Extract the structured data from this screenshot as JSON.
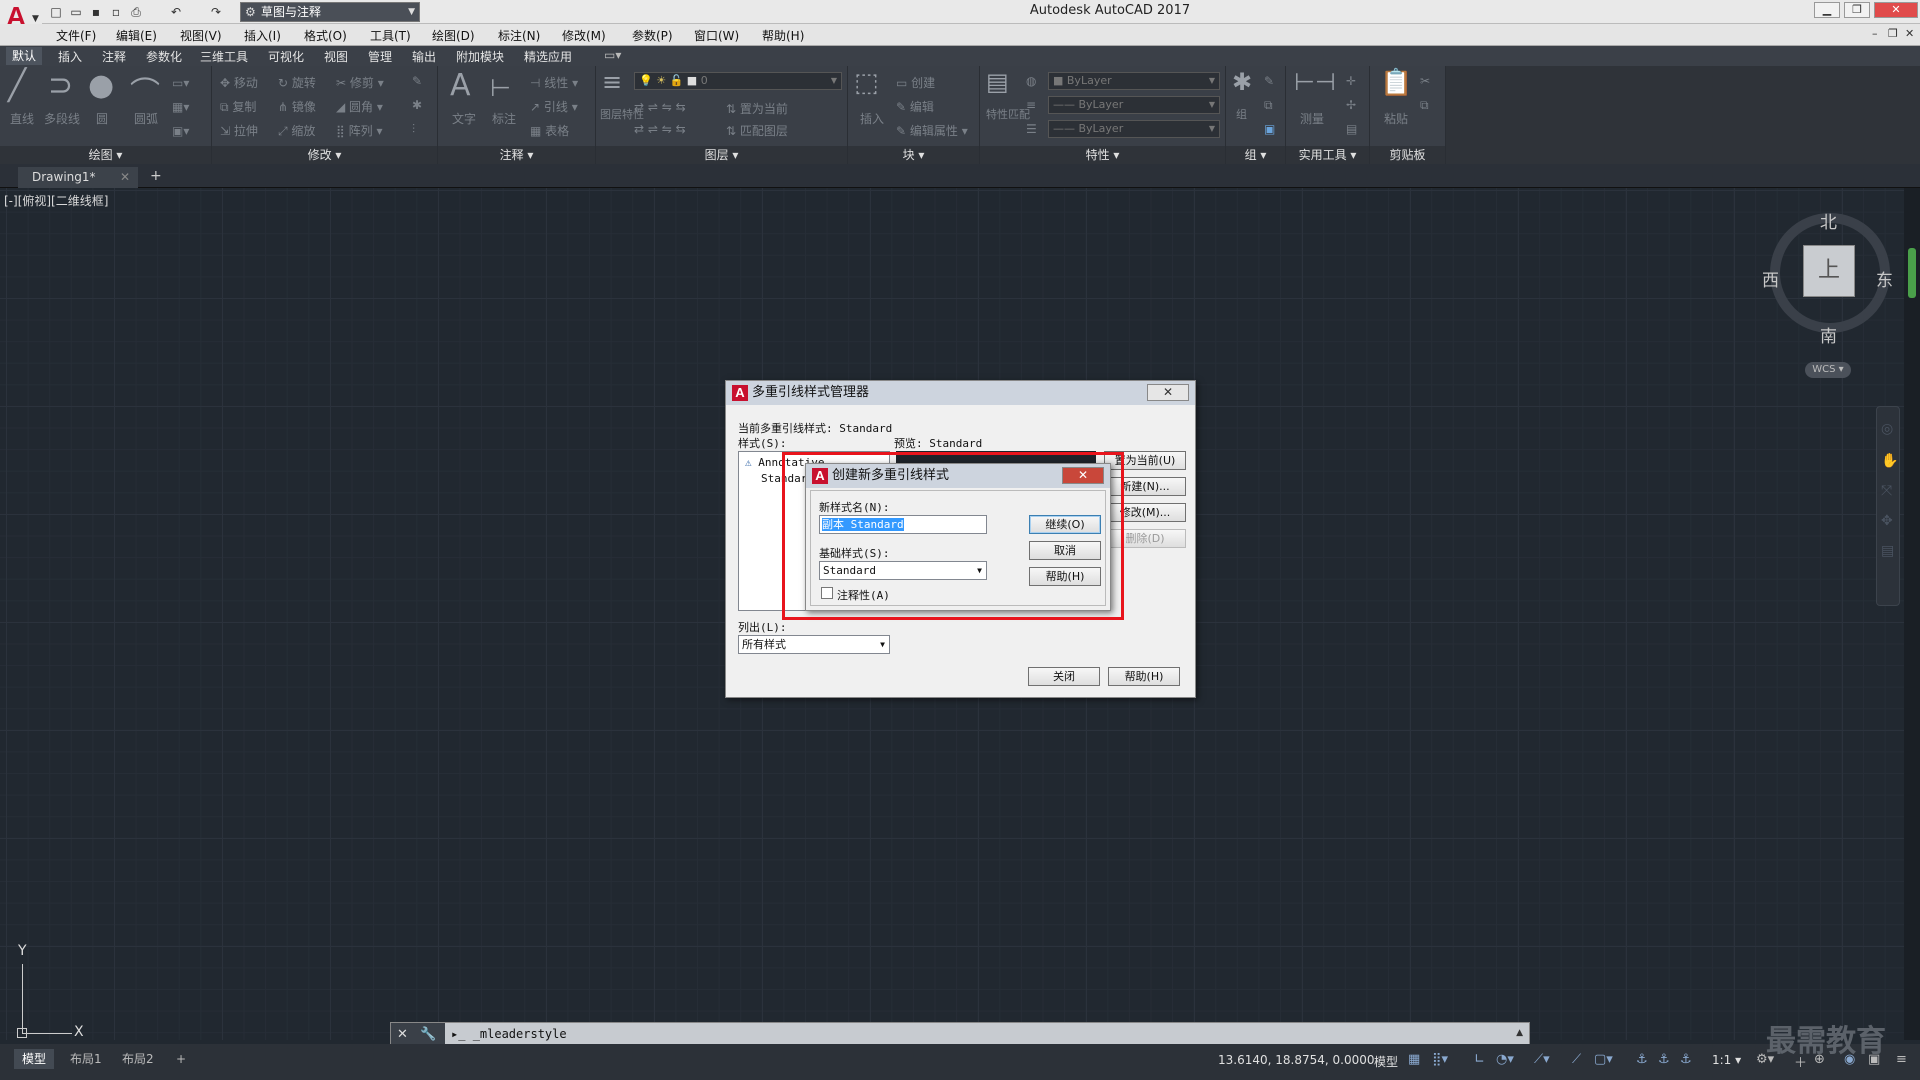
{
  "titlebar": {
    "app_title": "Autodesk AutoCAD 2017",
    "workspace": "草图与注释",
    "logo": "A",
    "qat_icons": [
      "new-icon",
      "open-icon",
      "save-icon",
      "saveas-icon",
      "print-icon",
      "undo-icon",
      "redo-icon"
    ]
  },
  "menubar": [
    "文件(F)",
    "编辑(E)",
    "视图(V)",
    "插入(I)",
    "格式(O)",
    "工具(T)",
    "绘图(D)",
    "标注(N)",
    "修改(M)",
    "参数(P)",
    "窗口(W)",
    "帮助(H)"
  ],
  "ribbon": {
    "tabs": [
      "默认",
      "插入",
      "注释",
      "参数化",
      "三维工具",
      "可视化",
      "视图",
      "管理",
      "输出",
      "附加模块",
      "精选应用"
    ],
    "active_tab": "默认",
    "panels": [
      "绘图",
      "修改",
      "注释",
      "图层",
      "块",
      "特性",
      "组",
      "实用工具",
      "剪贴板"
    ],
    "draw_tools": [
      "直线",
      "多段线",
      "圆",
      "圆弧"
    ],
    "modify_tools": [
      "移动",
      "旋转",
      "修剪",
      "复制",
      "镜像",
      "圆角",
      "拉伸",
      "缩放",
      "阵列"
    ],
    "annotate_tools": [
      "文字",
      "标注",
      "线性",
      "引线",
      "表格"
    ],
    "layer_tools": [
      "图层特性",
      "置为当前",
      "匹配图层"
    ],
    "layer_value": "0",
    "block_tools": [
      "插入",
      "创建",
      "编辑",
      "编辑属性"
    ],
    "property_tools": [
      "特性匹配"
    ],
    "bylayer": [
      "ByLayer",
      "ByLayer",
      "ByLayer"
    ],
    "utility_tools": [
      "测量"
    ],
    "clipboard_tools": [
      "粘贴"
    ],
    "group_tools": [
      "组"
    ]
  },
  "filetab": {
    "name": "Drawing1*"
  },
  "viewport": {
    "label": "[-][俯视][二维线框]"
  },
  "viewcube": {
    "top": "上",
    "north": "北",
    "south": "南",
    "west": "西",
    "east": "东",
    "wcs": "WCS"
  },
  "ucs": {
    "x": "X",
    "y": "Y"
  },
  "command": {
    "text": "_mleaderstyle"
  },
  "status": {
    "layouts": [
      "模型",
      "布局1",
      "布局2"
    ],
    "coords": "13.6140, 18.8754, 0.0000",
    "model": "模型",
    "scale": "1:1"
  },
  "watermark": "最需教育",
  "mls_dialog": {
    "title": "多重引线样式管理器",
    "current_label": "当前多重引线样式:",
    "current_value": "Standard",
    "styles_label": "样式(S):",
    "styles": [
      "Annotative",
      "Standard"
    ],
    "preview_label": "预览:",
    "preview_value": "Standard",
    "list_label": "列出(L):",
    "list_value": "所有样式",
    "buttons": {
      "set_current": "置为当前(U)",
      "new": "新建(N)...",
      "modify": "修改(M)...",
      "delete": "删除(D)",
      "close": "关闭",
      "help": "帮助(H)"
    }
  },
  "new_dialog": {
    "title": "创建新多重引线样式",
    "name_label": "新样式名(N):",
    "name_value": "副本 Standard",
    "base_label": "基础样式(S):",
    "base_value": "Standard",
    "annotative_label": "注释性(A)",
    "buttons": {
      "continue": "继续(O)",
      "cancel": "取消",
      "help": "帮助(H)"
    }
  },
  "colors": {
    "canvas": "#212830",
    "ribbon": "#3a3f47",
    "highlight": "#e8141c",
    "dialog": "#f0f0f0"
  }
}
